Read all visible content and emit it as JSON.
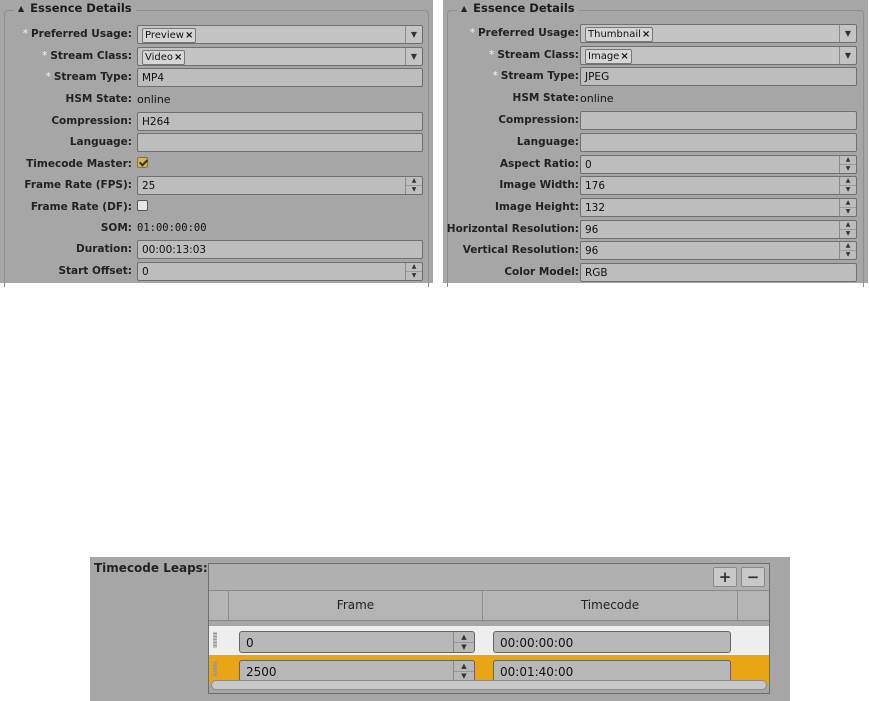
{
  "left_panel": {
    "title": "Essence Details",
    "fields": {
      "preferred_usage": {
        "label": "Preferred Usage:",
        "token": "Preview",
        "required": "*"
      },
      "stream_class": {
        "label": "Stream Class:",
        "token": "Video",
        "required": "*"
      },
      "stream_type": {
        "label": "Stream Type:",
        "value": "MP4",
        "required": "*"
      },
      "hsm_state": {
        "label": "HSM State:",
        "value": "online"
      },
      "compression": {
        "label": "Compression:",
        "value": "H264"
      },
      "language": {
        "label": "Language:",
        "value": ""
      },
      "timecode_master": {
        "label": "Timecode Master:",
        "checked": true
      },
      "frame_rate": {
        "label": "Frame Rate (FPS):",
        "value": "25"
      },
      "frame_rate_df": {
        "label": "Frame Rate (DF):",
        "checked": false
      },
      "som": {
        "label": "SOM:",
        "value": "01:00:00:00"
      },
      "duration": {
        "label": "Duration:",
        "value": "00:00:13:03"
      },
      "start_offset": {
        "label": "Start Offset:",
        "value": "0"
      }
    }
  },
  "right_panel": {
    "title": "Essence Details",
    "fields": {
      "preferred_usage": {
        "label": "Preferred Usage:",
        "token": "Thumbnail",
        "required": "*"
      },
      "stream_class": {
        "label": "Stream Class:",
        "token": "Image",
        "required": "*"
      },
      "stream_type": {
        "label": "Stream Type:",
        "value": "JPEG",
        "required": "*"
      },
      "hsm_state": {
        "label": "HSM State:",
        "value": "online"
      },
      "compression": {
        "label": "Compression:",
        "value": ""
      },
      "language": {
        "label": "Language:",
        "value": ""
      },
      "aspect_ratio": {
        "label": "Aspect Ratio:",
        "value": "0"
      },
      "image_width": {
        "label": "Image Width:",
        "value": "176"
      },
      "image_height": {
        "label": "Image Height:",
        "value": "132"
      },
      "horizontal_resolution": {
        "label": "Horizontal Resolution:",
        "value": "96"
      },
      "vertical_resolution": {
        "label": "Vertical Resolution:",
        "value": "96"
      },
      "color_model": {
        "label": "Color Model:",
        "value": "RGB"
      }
    }
  },
  "timecode_leaps": {
    "label": "Timecode Leaps:",
    "add_button": "+",
    "remove_button": "−",
    "columns": [
      "Frame",
      "Timecode"
    ],
    "rows": [
      {
        "frame": "0",
        "timecode": "00:00:00:00",
        "selected": false
      },
      {
        "frame": "2500",
        "timecode": "00:01:40:00",
        "selected": true
      }
    ]
  },
  "icons": {
    "collapse": "triangle-up-icon",
    "dropdown": "chevron-down-icon",
    "remove_token": "x-icon",
    "spinner": "spinner-arrows-icon"
  },
  "colors": {
    "panel_bg": "#a6a6a6",
    "selected_row": "#eaa514",
    "checkbox_checked": "#d2b35a"
  }
}
